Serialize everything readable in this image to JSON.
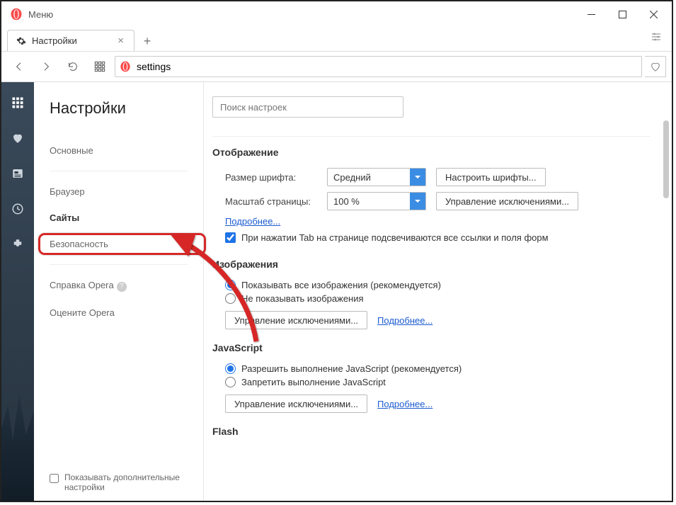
{
  "titlebar": {
    "menu_label": "Меню"
  },
  "tabs": {
    "active_label": "Настройки"
  },
  "addressbar": {
    "url": "settings"
  },
  "sidebar": {
    "title": "Настройки",
    "items": [
      {
        "label": "Основные"
      },
      {
        "label": "Браузер"
      },
      {
        "label": "Сайты"
      },
      {
        "label": "Безопасность"
      }
    ],
    "help_label": "Справка Opera",
    "rate_label": "Оцените Opera",
    "show_advanced_label": "Показывать дополнительные настройки"
  },
  "main": {
    "search_placeholder": "Поиск настроек",
    "display": {
      "title": "Отображение",
      "font_label": "Размер шрифта:",
      "font_value": "Средний",
      "font_button": "Настроить шрифты...",
      "zoom_label": "Масштаб страницы:",
      "zoom_value": "100 %",
      "zoom_button": "Управление исключениями...",
      "more_link": "Подробнее...",
      "tab_checkbox_label": "При нажатии Tab на странице подсвечиваются все ссылки и поля форм"
    },
    "images": {
      "title": "Изображения",
      "opt_all": "Показывать все изображения (рекомендуется)",
      "opt_none": "Не показывать изображения",
      "exceptions_button": "Управление исключениями...",
      "more_link": "Подробнее..."
    },
    "javascript": {
      "title": "JavaScript",
      "opt_allow": "Разрешить выполнение JavaScript (рекомендуется)",
      "opt_block": "Запретить выполнение JavaScript",
      "exceptions_button": "Управление исключениями...",
      "more_link": "Подробнее..."
    },
    "flash": {
      "title": "Flash"
    }
  }
}
